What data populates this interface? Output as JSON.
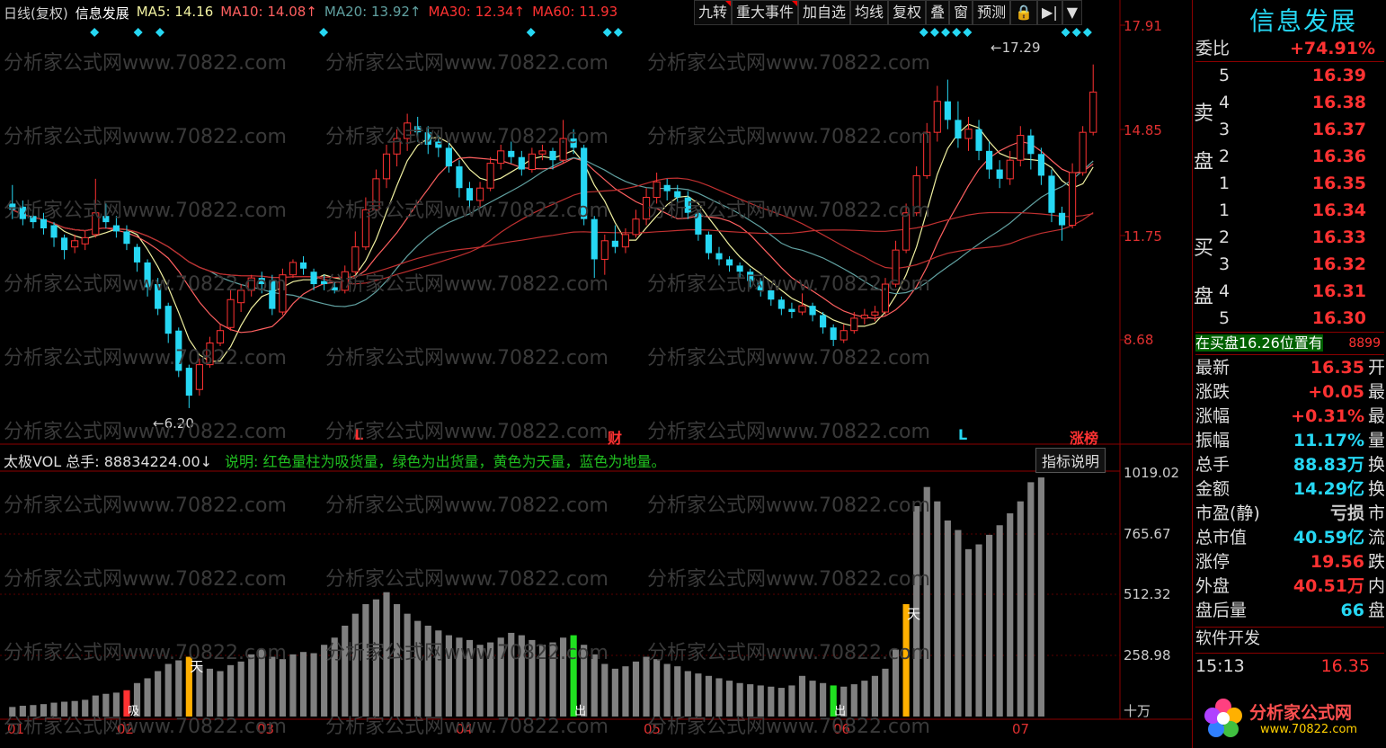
{
  "legend": {
    "period": "日线(复权)",
    "stock_name": "信息发展",
    "ma5": "MA5: 14.16",
    "ma10": "MA10: 14.08↑",
    "ma20": "MA20: 13.92↑",
    "ma30": "MA30: 12.34↑",
    "ma60": "MA60: 11.93"
  },
  "toolbar": [
    "九转",
    "重大事件",
    "加自选",
    "均线",
    "复权",
    "叠",
    "窗",
    "预测",
    "🔒",
    "▶|",
    "▼"
  ],
  "colors": {
    "up": "#ff3232",
    "down": "#26d7f3",
    "ma5": "#f0f0a0",
    "ma10": "#ff6060",
    "ma20": "#60a0a0",
    "ma30": "#c03030",
    "ma60": "#c03030",
    "yellow": "#ffb000",
    "green": "#20e020",
    "gray": "#808080",
    "accent": "#26d7f3"
  },
  "price_axis": [
    "17.91",
    "14.85",
    "11.75",
    "8.68"
  ],
  "price_annotations": {
    "high": "←17.29",
    "low": "←6.20"
  },
  "markers": {
    "L1": "L",
    "cai": "财",
    "L2": "L",
    "zhangbang": "涨榜"
  },
  "indicator": {
    "title": "太极VOL 总手: 88834224.00↓",
    "desc": "说明: 红色量柱为吸货量，绿色为出货量，黄色为天量，蓝色为地量。",
    "help_button": "指标说明",
    "labels": {
      "tian": "天",
      "xi": "吸",
      "chu": "出"
    }
  },
  "vol_axis": [
    "1019.02",
    "765.67",
    "512.32",
    "258.98",
    "十万"
  ],
  "dates": [
    "01",
    "02",
    "03",
    "04",
    "05",
    "06",
    "07"
  ],
  "side": {
    "title": "信息发展",
    "webi_label": "委比",
    "webi_value": "+74.91%",
    "sell_label": "卖盘",
    "buy_label": "买盘",
    "sells": [
      {
        "n": "5",
        "p": "16.39"
      },
      {
        "n": "4",
        "p": "16.38"
      },
      {
        "n": "3",
        "p": "16.37"
      },
      {
        "n": "2",
        "p": "16.36"
      },
      {
        "n": "1",
        "p": "16.35"
      }
    ],
    "buys": [
      {
        "n": "1",
        "p": "16.34"
      },
      {
        "n": "2",
        "p": "16.33"
      },
      {
        "n": "3",
        "p": "16.32"
      },
      {
        "n": "4",
        "p": "16.31"
      },
      {
        "n": "5",
        "p": "16.30"
      }
    ],
    "notice": "在买盘16.26位置有",
    "notice_num": "8899",
    "stats": [
      {
        "k": "最新",
        "v": "16.35",
        "c": "#ff3232",
        "s": "开"
      },
      {
        "k": "涨跌",
        "v": "+0.05",
        "c": "#ff3232",
        "s": "最"
      },
      {
        "k": "涨幅",
        "v": "+0.31%",
        "c": "#ff3232",
        "s": "最"
      },
      {
        "k": "振幅",
        "v": "11.17%",
        "c": "#26d7f3",
        "s": "量"
      },
      {
        "k": "总手",
        "v": "88.83万",
        "c": "#26d7f3",
        "s": "换"
      },
      {
        "k": "金额",
        "v": "14.29亿",
        "c": "#26d7f3",
        "s": "换"
      },
      {
        "k": "市盈(静)",
        "v": "亏损",
        "c": "#ccc",
        "s": "市"
      },
      {
        "k": "总市值",
        "v": "40.59亿",
        "c": "#26d7f3",
        "s": "流"
      },
      {
        "k": "涨停",
        "v": "19.56",
        "c": "#ff3232",
        "s": "跌"
      },
      {
        "k": "外盘",
        "v": "40.51万",
        "c": "#ff3232",
        "s": "内"
      },
      {
        "k": "盘后量",
        "v": "66",
        "c": "#26d7f3",
        "s": "盘"
      }
    ],
    "industry": "软件开发",
    "time": "15:13",
    "last_price": "16.35"
  },
  "watermark": "分析家公式网www.70822.com",
  "logo": {
    "title": "分析家公式网",
    "url": "www.70822.com"
  },
  "chart_data": {
    "type": "candlestick",
    "xlabel": "",
    "ylabel": "",
    "ylim": [
      5.5,
      18.5
    ],
    "candles": [
      [
        12.8,
        12.6,
        13.4,
        12.3
      ],
      [
        12.7,
        12.3,
        12.9,
        12.1
      ],
      [
        12.4,
        12.2,
        12.6,
        12.0
      ],
      [
        12.3,
        12.0,
        12.5,
        11.8
      ],
      [
        12.1,
        11.7,
        12.2,
        11.4
      ],
      [
        11.7,
        11.3,
        11.8,
        11.0
      ],
      [
        11.4,
        11.6,
        11.8,
        11.2
      ],
      [
        11.5,
        11.7,
        11.9,
        11.3
      ],
      [
        11.8,
        12.5,
        13.6,
        11.7
      ],
      [
        12.4,
        12.2,
        12.8,
        12.0
      ],
      [
        12.1,
        11.9,
        12.4,
        11.7
      ],
      [
        11.9,
        11.5,
        12.1,
        11.3
      ],
      [
        11.4,
        10.9,
        11.5,
        10.6
      ],
      [
        10.9,
        10.1,
        11.0,
        9.8
      ],
      [
        10.2,
        9.4,
        10.4,
        9.2
      ],
      [
        9.5,
        8.6,
        9.6,
        8.3
      ],
      [
        8.7,
        7.4,
        8.8,
        7.2
      ],
      [
        7.5,
        6.6,
        7.6,
        6.2
      ],
      [
        6.8,
        7.6,
        7.8,
        6.6
      ],
      [
        7.6,
        8.3,
        8.5,
        7.5
      ],
      [
        8.3,
        8.7,
        8.9,
        8.2
      ],
      [
        8.8,
        9.7,
        10.0,
        8.7
      ],
      [
        9.6,
        10.0,
        10.2,
        9.3
      ],
      [
        10.0,
        10.4,
        10.5,
        9.8
      ],
      [
        10.4,
        10.2,
        10.6,
        9.9
      ],
      [
        10.3,
        9.4,
        10.5,
        9.2
      ],
      [
        9.3,
        10.5,
        10.7,
        9.2
      ],
      [
        10.5,
        10.9,
        11.0,
        10.4
      ],
      [
        10.9,
        10.7,
        11.1,
        10.5
      ],
      [
        10.6,
        10.2,
        10.7,
        10.0
      ],
      [
        10.3,
        10.2,
        10.5,
        10.0
      ],
      [
        10.1,
        10.0,
        10.3,
        9.9
      ],
      [
        10.0,
        10.6,
        10.8,
        9.9
      ],
      [
        10.6,
        11.4,
        11.9,
        10.5
      ],
      [
        11.4,
        12.6,
        13.0,
        11.3
      ],
      [
        12.6,
        13.6,
        13.9,
        12.4
      ],
      [
        13.6,
        14.4,
        14.7,
        13.3
      ],
      [
        14.4,
        14.9,
        15.2,
        14.0
      ],
      [
        14.9,
        15.4,
        15.7,
        14.5
      ],
      [
        15.3,
        15.1,
        15.6,
        14.8
      ],
      [
        15.1,
        14.7,
        15.3,
        14.4
      ],
      [
        14.8,
        14.6,
        15.0,
        14.3
      ],
      [
        14.6,
        14.0,
        14.8,
        13.8
      ],
      [
        14.0,
        13.3,
        14.2,
        13.0
      ],
      [
        13.3,
        12.9,
        13.5,
        12.6
      ],
      [
        12.9,
        13.3,
        13.5,
        12.7
      ],
      [
        13.3,
        14.1,
        14.3,
        13.2
      ],
      [
        14.1,
        14.5,
        14.7,
        13.9
      ],
      [
        14.5,
        14.3,
        14.8,
        14.1
      ],
      [
        14.3,
        13.9,
        14.5,
        13.7
      ],
      [
        13.9,
        14.4,
        14.6,
        13.8
      ],
      [
        14.4,
        14.5,
        14.7,
        14.2
      ],
      [
        14.5,
        14.2,
        14.6,
        13.9
      ],
      [
        14.2,
        14.9,
        15.5,
        14.1
      ],
      [
        14.9,
        14.6,
        15.2,
        14.4
      ],
      [
        14.6,
        12.3,
        14.7,
        12.1
      ],
      [
        12.3,
        11.0,
        12.4,
        10.4
      ],
      [
        11.0,
        11.6,
        11.8,
        10.5
      ],
      [
        11.6,
        11.4,
        12.1,
        11.2
      ],
      [
        11.4,
        11.8,
        12.0,
        11.2
      ],
      [
        11.8,
        12.3,
        12.6,
        11.7
      ],
      [
        12.3,
        13.0,
        13.3,
        12.1
      ],
      [
        13.0,
        13.5,
        13.8,
        12.8
      ],
      [
        13.4,
        13.2,
        13.6,
        12.9
      ],
      [
        13.2,
        13.0,
        13.4,
        12.8
      ],
      [
        13.0,
        12.5,
        13.2,
        12.3
      ],
      [
        12.5,
        11.8,
        12.6,
        11.6
      ],
      [
        11.8,
        11.2,
        11.9,
        11.0
      ],
      [
        11.2,
        11.0,
        11.4,
        10.8
      ],
      [
        11.0,
        10.8,
        11.1,
        10.6
      ],
      [
        10.8,
        10.6,
        10.9,
        10.4
      ],
      [
        10.6,
        10.3,
        10.7,
        10.1
      ],
      [
        10.3,
        10.0,
        10.4,
        9.8
      ],
      [
        10.0,
        9.7,
        10.1,
        9.5
      ],
      [
        9.7,
        9.4,
        9.8,
        9.2
      ],
      [
        9.4,
        9.3,
        9.6,
        9.1
      ],
      [
        9.3,
        9.5,
        9.9,
        9.2
      ],
      [
        9.5,
        9.2,
        9.6,
        9.0
      ],
      [
        9.2,
        8.8,
        9.3,
        8.6
      ],
      [
        8.8,
        8.4,
        8.9,
        8.2
      ],
      [
        8.4,
        8.7,
        8.9,
        8.3
      ],
      [
        8.7,
        9.1,
        9.3,
        8.6
      ],
      [
        9.1,
        9.2,
        9.4,
        8.9
      ],
      [
        9.2,
        9.3,
        9.5,
        9.0
      ],
      [
        9.3,
        10.2,
        10.4,
        9.2
      ],
      [
        10.2,
        11.3,
        11.6,
        10.1
      ],
      [
        11.3,
        12.5,
        12.8,
        11.2
      ],
      [
        12.5,
        13.7,
        14.0,
        12.4
      ],
      [
        13.7,
        15.1,
        15.4,
        13.6
      ],
      [
        15.1,
        16.1,
        16.6,
        14.8
      ],
      [
        16.1,
        15.5,
        16.8,
        15.2
      ],
      [
        15.5,
        14.9,
        16.1,
        14.6
      ],
      [
        14.9,
        15.2,
        15.6,
        14.5
      ],
      [
        15.2,
        14.5,
        15.5,
        14.2
      ],
      [
        14.5,
        13.9,
        14.8,
        13.6
      ],
      [
        13.9,
        13.6,
        14.2,
        13.3
      ],
      [
        13.6,
        14.2,
        14.5,
        13.4
      ],
      [
        14.2,
        15.0,
        15.3,
        14.0
      ],
      [
        15.0,
        14.4,
        15.2,
        13.9
      ],
      [
        14.4,
        13.7,
        14.6,
        13.4
      ],
      [
        13.7,
        12.5,
        13.9,
        12.2
      ],
      [
        12.5,
        12.1,
        12.7,
        11.6
      ],
      [
        12.1,
        13.8,
        14.1,
        12.0
      ],
      [
        13.8,
        15.1,
        15.3,
        13.7
      ],
      [
        15.1,
        16.4,
        17.29,
        15.0
      ]
    ],
    "volume": [
      40,
      45,
      48,
      52,
      58,
      62,
      65,
      70,
      88,
      95,
      100,
      110,
      140,
      160,
      190,
      220,
      235,
      250,
      210,
      200,
      190,
      215,
      230,
      260,
      280,
      250,
      240,
      260,
      270,
      265,
      300,
      330,
      380,
      430,
      470,
      490,
      520,
      470,
      430,
      400,
      380,
      360,
      340,
      330,
      320,
      300,
      310,
      330,
      350,
      340,
      320,
      300,
      310,
      330,
      340,
      300,
      260,
      220,
      200,
      210,
      230,
      250,
      240,
      220,
      210,
      190,
      180,
      170,
      160,
      150,
      140,
      135,
      130,
      125,
      120,
      130,
      170,
      150,
      140,
      130,
      125,
      135,
      150,
      170,
      200,
      280,
      470,
      880,
      960,
      900,
      820,
      780,
      700,
      720,
      760,
      800,
      850,
      900,
      980,
      1000
    ],
    "volume_special": {
      "tian_index": [
        17,
        86
      ],
      "xi_index": [
        11
      ],
      "chu_index": [
        54,
        79
      ]
    }
  }
}
